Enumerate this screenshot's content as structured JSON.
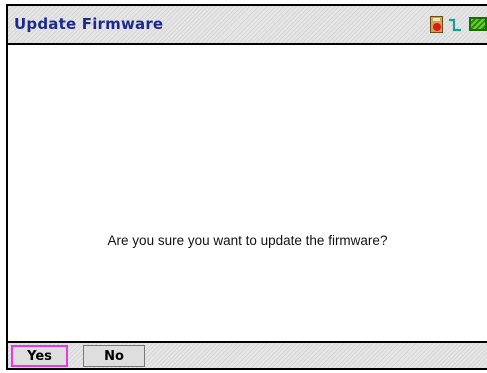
{
  "window": {
    "title": "Update Firmware"
  },
  "status": {
    "icons": [
      "sd-card-icon",
      "signal-icon",
      "battery-icon"
    ],
    "battery_color": "#6cd13a",
    "sd_card_color": "#c9a45a",
    "signal_color": "#1a9c9c"
  },
  "dialog": {
    "message": "Are you sure you want to update the firmware?"
  },
  "buttons": {
    "yes_label": "Yes",
    "no_label": "No",
    "focused": "Yes",
    "focus_color": "#e23be0"
  },
  "theme": {
    "title_color": "#1c2a8c"
  }
}
